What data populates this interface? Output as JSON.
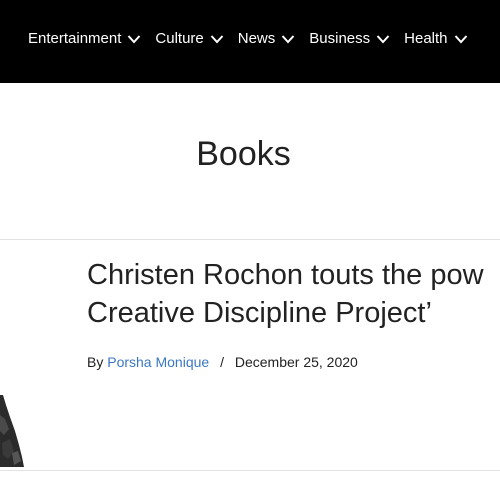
{
  "nav": {
    "items": [
      {
        "label": "Entertainment"
      },
      {
        "label": "Culture"
      },
      {
        "label": "News"
      },
      {
        "label": "Business"
      },
      {
        "label": "Health"
      }
    ]
  },
  "page": {
    "title": "Books"
  },
  "article": {
    "title_line1": "Christen Rochon touts the pow",
    "title_line2": "Creative Discipline Project’",
    "by_label": "By",
    "author": "Porsha Monique",
    "separator": "/",
    "date": "December 25, 2020"
  },
  "colors": {
    "nav_background": "#000000",
    "nav_text": "#ffffff",
    "author_link": "#3b78c2",
    "text": "#222222"
  }
}
